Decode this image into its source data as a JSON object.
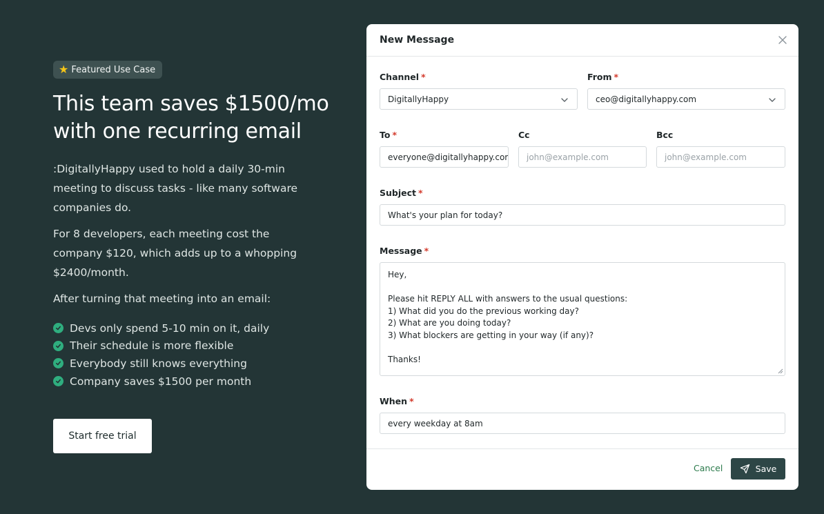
{
  "promo": {
    "badge_icon": "star-icon",
    "badge_label": "Featured Use Case",
    "headline": "This team saves $1500/mo with one recurring email",
    "paragraphs": [
      ":DigitallyHappy used to hold a daily 30-min meeting to discuss tasks - like many software companies do.",
      "For 8 developers, each meeting cost the company $120, which adds up to a whopping $2400/month.",
      "After turning that meeting into an email:"
    ],
    "benefits": [
      "Devs only spend 5-10 min on it, daily",
      "Their schedule is more flexible",
      "Everybody still knows everything",
      "Company saves $1500 per month"
    ],
    "cta_label": "Start free trial",
    "check_color": "#2fae7f",
    "background_color": "#233536"
  },
  "modal": {
    "title": "New Message",
    "close_icon": "close-icon",
    "required_mark": "*",
    "channel": {
      "label": "Channel",
      "value": "DigitallyHappy"
    },
    "from": {
      "label": "From",
      "value": "ceo@digitallyhappy.com"
    },
    "to": {
      "label": "To",
      "value": "everyone@digitallyhappy.com"
    },
    "cc": {
      "label": "Cc",
      "placeholder": "john@example.com"
    },
    "bcc": {
      "label": "Bcc",
      "placeholder": "john@example.com"
    },
    "subject": {
      "label": "Subject",
      "value": "What's your plan for today?"
    },
    "message": {
      "label": "Message",
      "lines": [
        "Hey,",
        "",
        "Please hit REPLY ALL with answers to the usual questions:",
        "1) What did you do the previous working day?",
        "2) What are you doing today?",
        "3) What blockers are getting in your way (if any)?",
        "",
        "Thanks!"
      ]
    },
    "when": {
      "label": "When",
      "value": "every weekday at 8am"
    },
    "cancel_label": "Cancel",
    "save_label": "Save",
    "save_icon": "send-icon",
    "accent_color": "#2d4646",
    "required_color": "#d33a2c"
  }
}
